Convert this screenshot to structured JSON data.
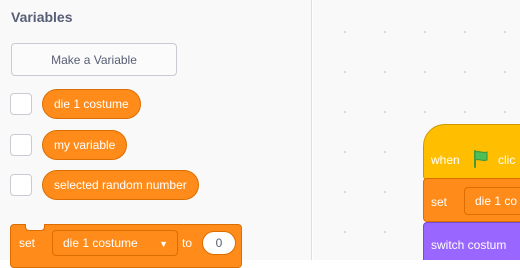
{
  "palette": {
    "section_title": "Variables",
    "make_variable_label": "Make a Variable",
    "variables": [
      {
        "name": "die 1 costume",
        "checked": false
      },
      {
        "name": "my variable",
        "checked": false
      },
      {
        "name": "selected random number",
        "checked": false
      }
    ],
    "set_block": {
      "label": "set",
      "dropdown_value": "die 1 costume",
      "to_label": "to",
      "value": "0"
    }
  },
  "workspace": {
    "hat_block": {
      "when": "when",
      "click": "clic",
      "icon": "green-flag-icon"
    },
    "set_block": {
      "label": "set",
      "dropdown_value": "die 1 co"
    },
    "switch_block": {
      "label": "switch costum"
    }
  },
  "colors": {
    "variables_orange": "#ff8c1a",
    "events_yellow": "#ffbf00",
    "looks_purple": "#9966ff",
    "text_gray": "#575e75"
  }
}
